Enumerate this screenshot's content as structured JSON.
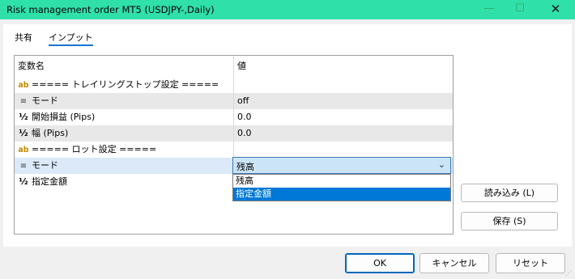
{
  "window": {
    "title": "Risk management order MT5 (USDJPY-,Daily)",
    "minimize_glyph": "—",
    "maximize_glyph": "☐",
    "close_glyph": "✕"
  },
  "tabs": [
    {
      "label": "共有",
      "active": false
    },
    {
      "label": "インプット",
      "active": true
    }
  ],
  "grid": {
    "headers": {
      "name": "変数名",
      "value": "値"
    },
    "rows": [
      {
        "icon": "ab",
        "name": "===== トレイリングストップ設定 =====",
        "value": ""
      },
      {
        "icon": "≡",
        "name": "モード",
        "value": "off"
      },
      {
        "icon": "½",
        "name": "開始損益 (Pips)",
        "value": "0.0"
      },
      {
        "icon": "½",
        "name": "幅 (Pips)",
        "value": "0.0"
      },
      {
        "icon": "ab",
        "name": "===== ロット設定 =====",
        "value": ""
      },
      {
        "icon": "≡",
        "name": "モード",
        "value": "残高"
      },
      {
        "icon": "½",
        "name": "指定金額",
        "value": ""
      }
    ]
  },
  "dropdown": {
    "selected": "残高",
    "arrow": "⌄",
    "options": [
      "残高",
      "指定金額"
    ],
    "highlighted": "指定金額"
  },
  "side_buttons": {
    "load": "読み込み (L)",
    "save": "保存 (S)"
  },
  "footer": {
    "ok": "OK",
    "cancel": "キャンセル",
    "reset": "リセット"
  },
  "colors": {
    "titlebar": "#2fe0a8",
    "accent": "#0078d7",
    "selected_row": "#dbe9f8"
  }
}
